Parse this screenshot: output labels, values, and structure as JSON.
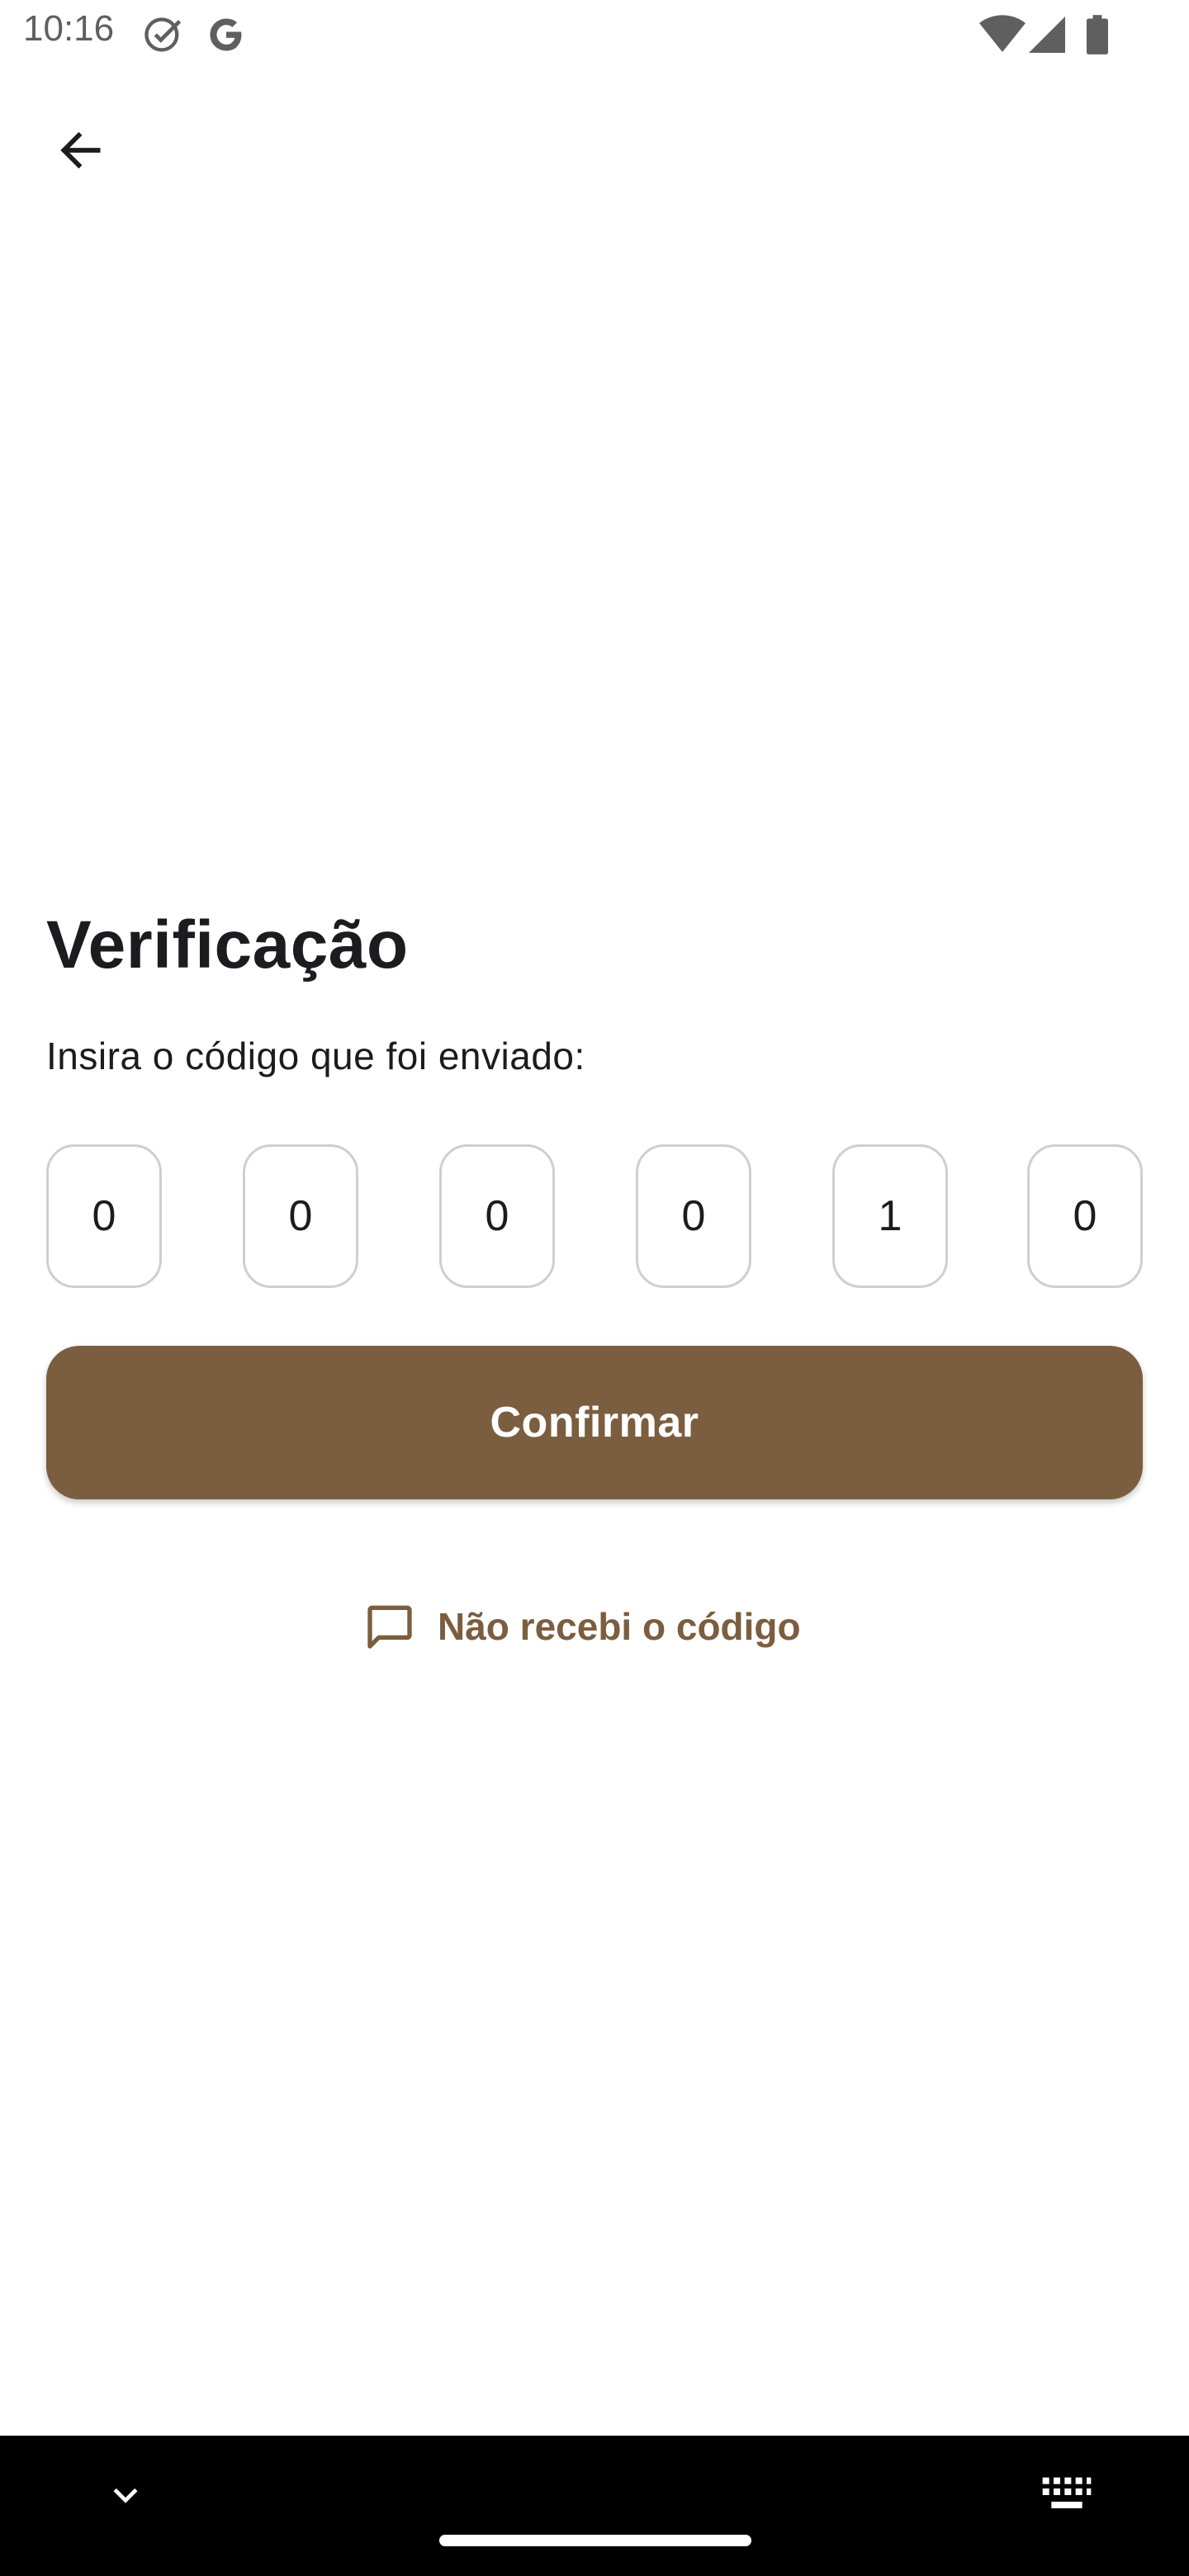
{
  "status_bar": {
    "time": "10:16",
    "icons": [
      "check-circle-icon",
      "google-icon",
      "wifi-icon",
      "signal-icon",
      "battery-icon"
    ]
  },
  "app_bar": {
    "back_icon": "arrow-left-icon"
  },
  "verification": {
    "title": "Verificação",
    "subtitle": "Insira o código que foi enviado:",
    "code_digits": [
      "0",
      "0",
      "0",
      "0",
      "1",
      "0"
    ],
    "confirm_label": "Confirmar",
    "resend_label": "Não recebi o código",
    "resend_icon": "message-icon"
  },
  "nav_bar": {
    "icons": [
      "chevron-down-icon",
      "keyboard-icon"
    ]
  },
  "colors": {
    "accent": "#7b5e3f",
    "text": "#1c1b1f",
    "box_border": "#cfcfcf",
    "background": "#ffffff",
    "nav_background": "#000000"
  }
}
